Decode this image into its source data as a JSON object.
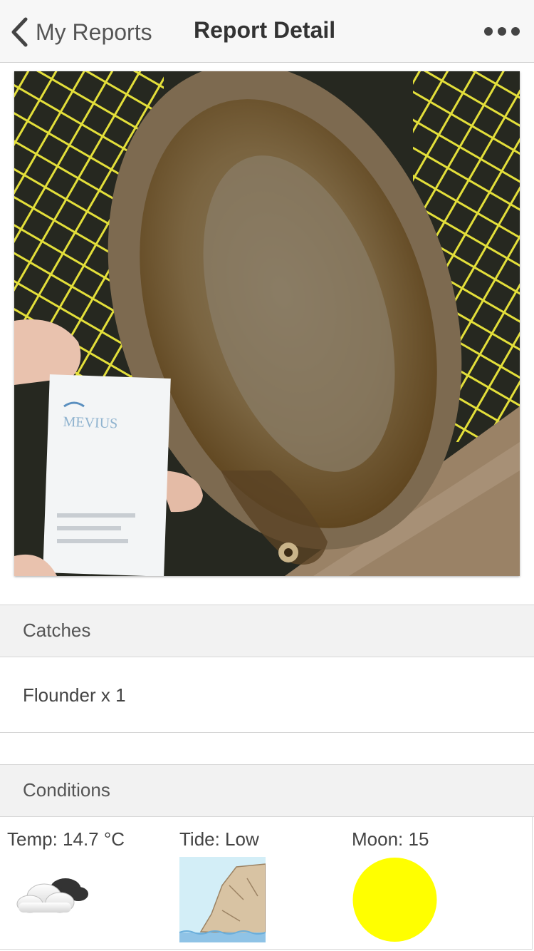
{
  "nav": {
    "back_label": "My Reports",
    "title": "Report Detail",
    "back_icon": "chevron-left-icon",
    "more_icon": "more-dots-icon"
  },
  "photo": {
    "subject": "flounder",
    "card_brand": "MEVIUS"
  },
  "catches": {
    "header": "Catches",
    "items": [
      "Flounder x 1"
    ]
  },
  "conditions": {
    "header": "Conditions",
    "temp_label": "Temp: 14.7 °C",
    "temp_icon": "cloudy-icon",
    "tide_label": "Tide: Low",
    "tide_icon": "low-tide-icon",
    "moon_label": "Moon: 15",
    "moon_icon": "full-moon-icon",
    "moon_color": "#ffff00"
  }
}
